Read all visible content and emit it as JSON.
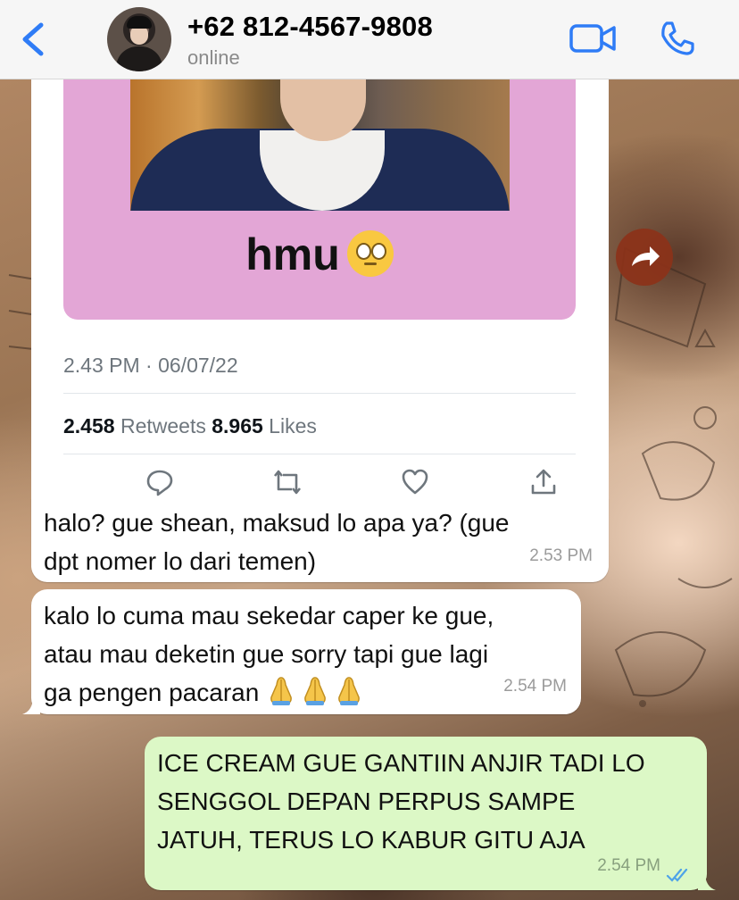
{
  "header": {
    "contact_name": "+62 812-4567-9808",
    "status": "online"
  },
  "tweet": {
    "caption": "hmu",
    "caption_emoji": "face-with-rolling-eyes",
    "timestamp": "2.43 PM · 06/07/22",
    "retweets_count": "2.458",
    "retweets_label": "Retweets",
    "likes_count": "8.965",
    "likes_label": "Likes"
  },
  "messages": [
    {
      "direction": "incoming",
      "lines": [
        "halo? gue shean, maksud lo apa ya? (gue",
        "dpt nomer lo dari temen)"
      ],
      "time": "2.53 PM"
    },
    {
      "direction": "incoming",
      "lines": [
        "kalo lo cuma mau sekedar caper ke gue,",
        "atau mau deketin gue sorry tapi gue lagi",
        "ga pengen pacaran"
      ],
      "emojis": [
        "folded-hands",
        "folded-hands",
        "folded-hands"
      ],
      "time": "2.54 PM"
    },
    {
      "direction": "outgoing",
      "lines": [
        "ICE CREAM GUE GANTIIN ANJIR TADI LO",
        "SENGGOL DEPAN PERPUS SAMPE",
        "JATUH, TERUS LO KABUR GITU AJA"
      ],
      "time": "2.54 PM",
      "read_receipt": "double-check-blue"
    }
  ],
  "colors": {
    "ios_blue": "#2f7cf6",
    "outgoing_bubble": "#dcf8c6",
    "incoming_bubble": "#ffffff",
    "tweet_media_bg": "#e3a6d6",
    "forward_button": "#8c3219"
  }
}
